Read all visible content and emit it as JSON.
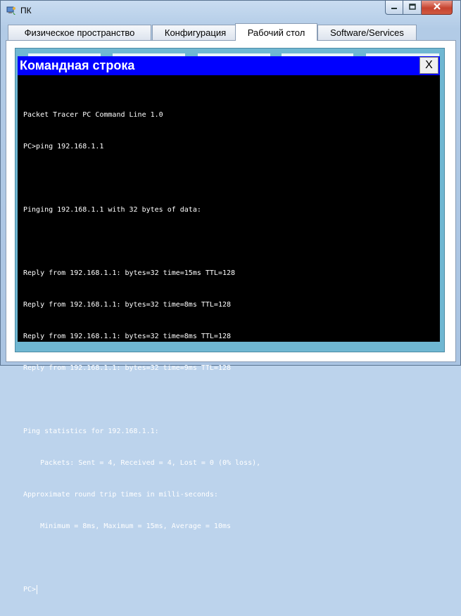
{
  "window": {
    "title": "ПК",
    "app_icon": "pc-icon",
    "controls": {
      "minimize_icon": "minimize-icon",
      "maximize_icon": "maximize-icon",
      "close_icon": "close-icon"
    }
  },
  "tabs": [
    {
      "label": "Физическое пространство",
      "active": false
    },
    {
      "label": "Конфигурация",
      "active": false
    },
    {
      "label": "Рабочий стол",
      "active": true
    },
    {
      "label": "Software/Services",
      "active": false
    }
  ],
  "command_prompt": {
    "title": "Командная строка",
    "close_label": "X",
    "lines": [
      "Packet Tracer PC Command Line 1.0",
      "PC>ping 192.168.1.1",
      "",
      "Pinging 192.168.1.1 with 32 bytes of data:",
      "",
      "Reply from 192.168.1.1: bytes=32 time=15ms TTL=128",
      "Reply from 192.168.1.1: bytes=32 time=8ms TTL=128",
      "Reply from 192.168.1.1: bytes=32 time=8ms TTL=128",
      "Reply from 192.168.1.1: bytes=32 time=9ms TTL=128",
      "",
      "Ping statistics for 192.168.1.1:",
      "    Packets: Sent = 4, Received = 4, Lost = 0 (0% loss),",
      "Approximate round trip times in milli-seconds:",
      "    Minimum = 8ms, Maximum = 15ms, Average = 10ms",
      ""
    ],
    "prompt": "PC>"
  },
  "colors": {
    "cmd_title_bg": "#0000ff",
    "terminal_bg": "#000000",
    "terminal_fg": "#ffffff",
    "desktop_bg": "#6fb7d2"
  }
}
